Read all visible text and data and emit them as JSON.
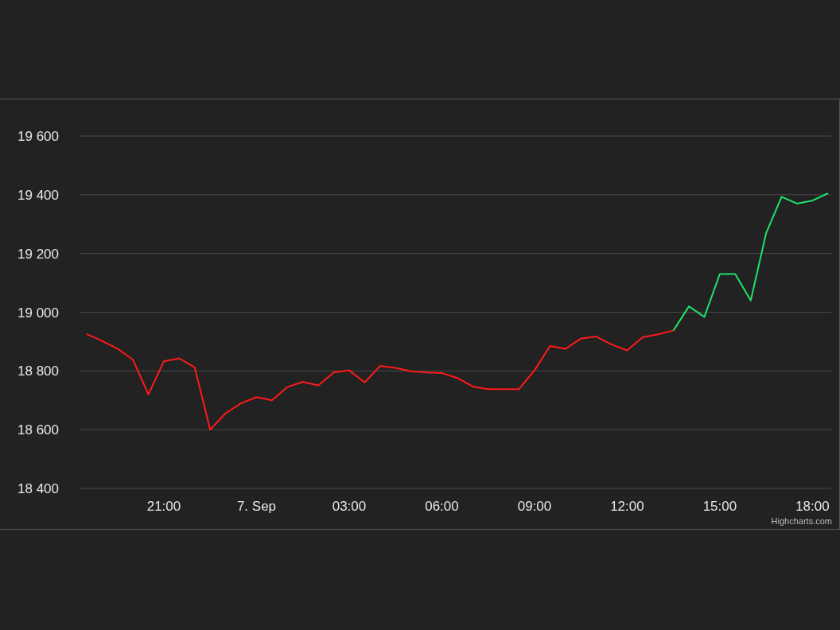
{
  "chart": {
    "credit": "Highcharts.com",
    "chart_data": {
      "type": "line",
      "categories": [
        null,
        null,
        null,
        null,
        null,
        "21:00",
        null,
        null,
        null,
        null,
        null,
        "7. Sep",
        null,
        null,
        null,
        null,
        null,
        "03:00",
        null,
        null,
        null,
        null,
        null,
        "06:00",
        null,
        null,
        null,
        null,
        null,
        "09:00",
        null,
        null,
        null,
        null,
        null,
        "12:00",
        null,
        null,
        null,
        null,
        null,
        "15:00",
        null,
        null,
        null,
        null,
        null,
        "18:00",
        null
      ],
      "series": [
        {
          "color": "#ff1a1a",
          "values": [
            18926,
            18902,
            18876,
            18838,
            18720,
            18833,
            18843,
            18812,
            18600,
            18656,
            18690,
            18711,
            18700,
            18745,
            18763,
            18751,
            18795,
            18802,
            18761,
            18817,
            18810,
            18799,
            18795,
            18793,
            18776,
            18747,
            18738,
            18738,
            18738,
            18802,
            18885,
            18875,
            18910,
            18917,
            18890,
            18870,
            18915,
            18925,
            18938,
            null,
            null,
            null,
            null,
            null,
            null,
            null,
            null,
            null,
            null
          ]
        },
        {
          "color": "#1ee36a",
          "values": [
            null,
            null,
            null,
            null,
            null,
            null,
            null,
            null,
            null,
            null,
            null,
            null,
            null,
            null,
            null,
            null,
            null,
            null,
            null,
            null,
            null,
            null,
            null,
            null,
            null,
            null,
            null,
            null,
            null,
            null,
            null,
            null,
            null,
            null,
            null,
            null,
            null,
            null,
            18938,
            19020,
            18984,
            19130,
            19130,
            19040,
            19270,
            19393,
            19370,
            19380,
            19405
          ]
        }
      ],
      "grid": true,
      "ylim": [
        18400,
        19600
      ],
      "yticks": [
        {
          "value": 18400,
          "label": "18 400"
        },
        {
          "value": 18600,
          "label": "18 600"
        },
        {
          "value": 18800,
          "label": "18 800"
        },
        {
          "value": 19000,
          "label": "19 000"
        },
        {
          "value": 19200,
          "label": "19 200"
        },
        {
          "value": 19400,
          "label": "19 400"
        },
        {
          "value": 19600,
          "label": "19 600"
        }
      ]
    }
  }
}
